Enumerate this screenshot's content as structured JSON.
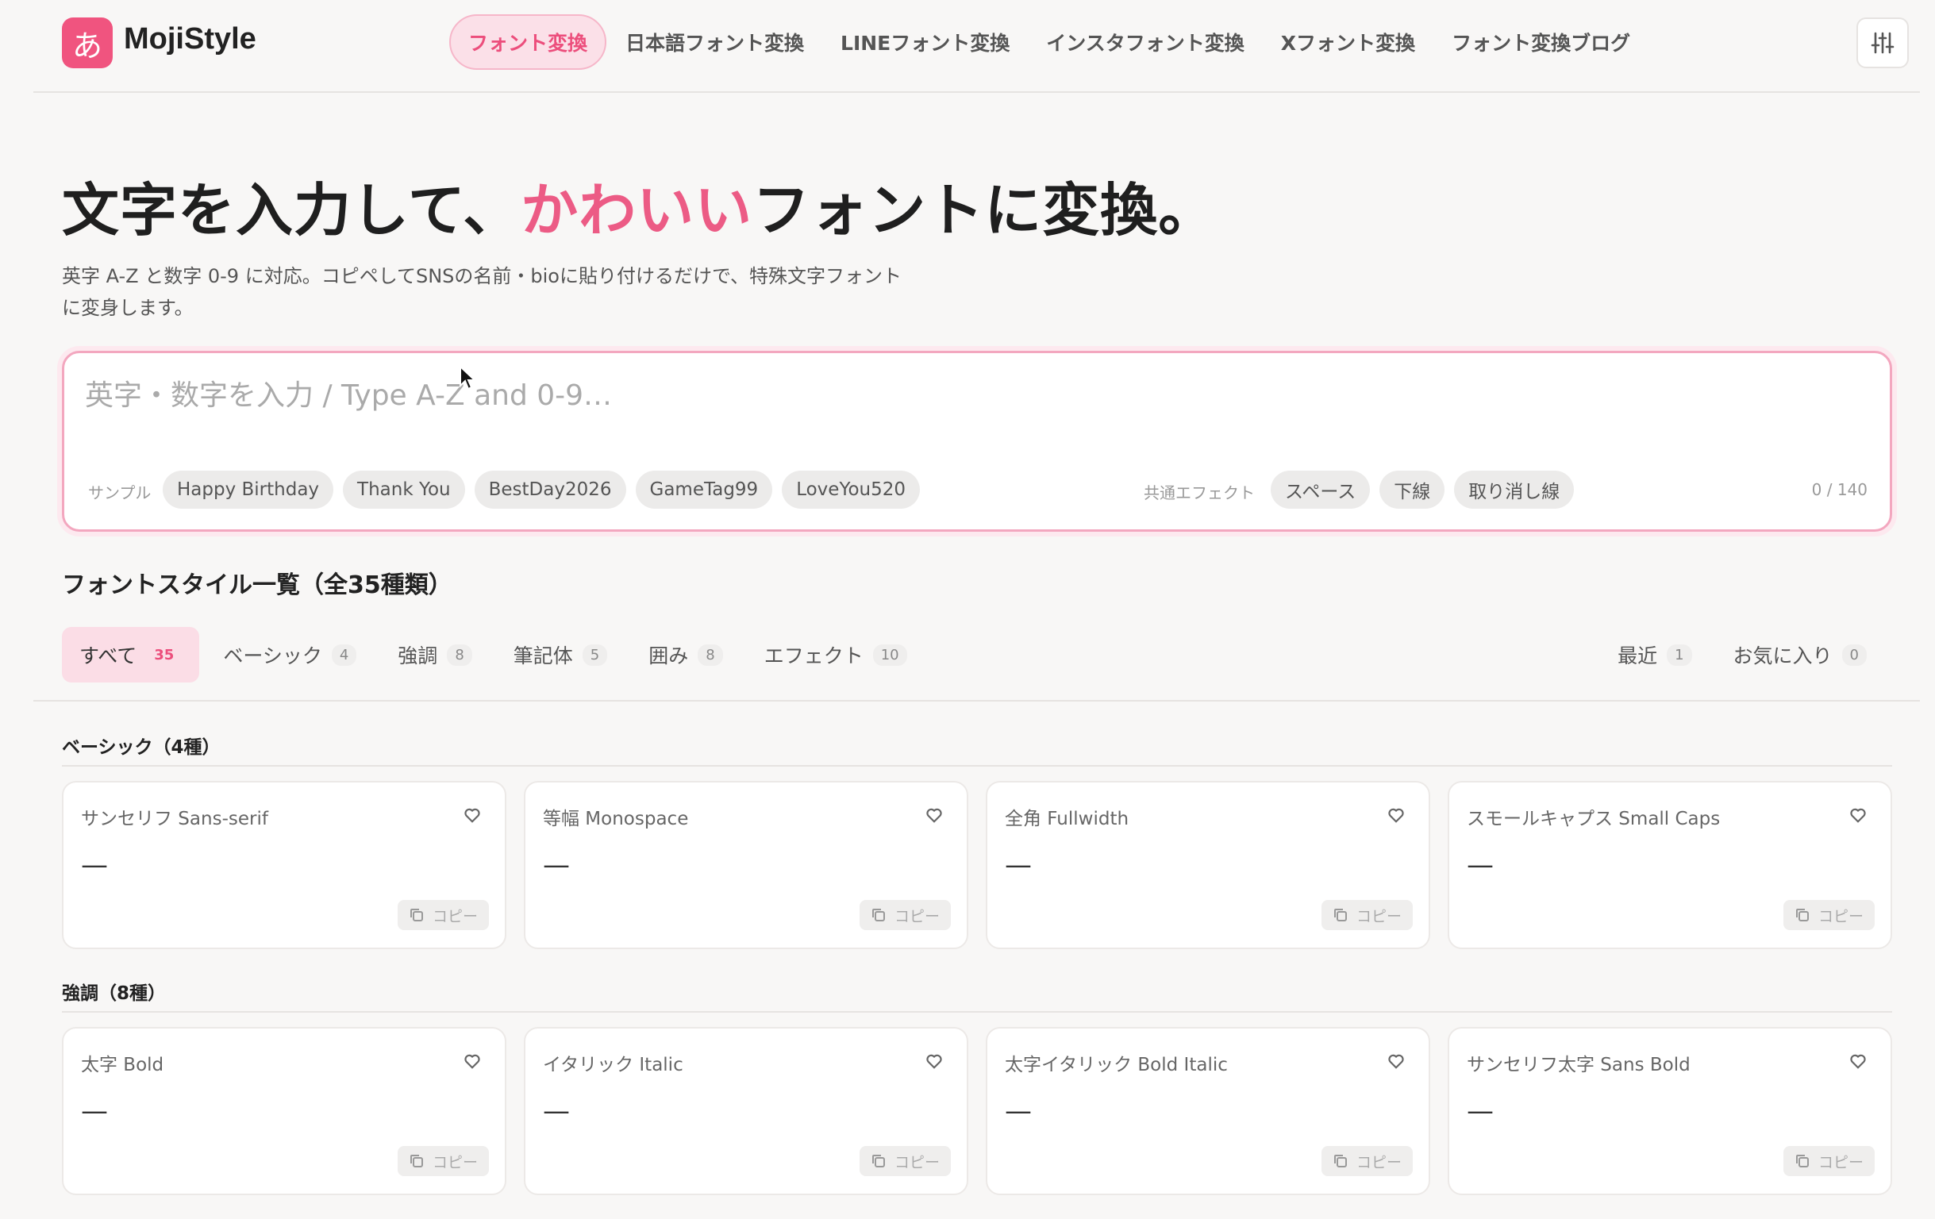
{
  "header": {
    "logo_mark": "あ",
    "logo_text": "MojiStyle",
    "nav": [
      {
        "label": "フォント変換",
        "active": true
      },
      {
        "label": "日本語フォント変換"
      },
      {
        "label": "LINEフォント変換"
      },
      {
        "label": "インスタフォント変換"
      },
      {
        "label": "Xフォント変換"
      },
      {
        "label": "フォント変換ブログ"
      }
    ],
    "settings_icon": "sliders-icon"
  },
  "hero": {
    "title_pre": "文字を入力して、",
    "title_accent": "かわいい",
    "title_post": "フォントに変換。",
    "desc": "英字 A-Z と数字 0-9 に対応。コピペしてSNSの名前・bioに貼り付けるだけで、特殊文字フォントに変身します。"
  },
  "input": {
    "value": "",
    "placeholder": "英字・数字を入力 / Type A-Z and 0-9…",
    "sample_label": "サンプル",
    "samples": [
      "Happy Birthday",
      "Thank You",
      "BestDay2026",
      "GameTag99",
      "LoveYou520"
    ],
    "effect_label": "共通エフェクト",
    "effects": [
      "スペース",
      "下線",
      "取り消し線"
    ],
    "counter": "0 / 140"
  },
  "list": {
    "title": "フォントスタイル一覧（全35種類）",
    "tabs": [
      {
        "label": "すべて",
        "count": "35",
        "active": true
      },
      {
        "label": "ベーシック",
        "count": "4"
      },
      {
        "label": "強調",
        "count": "8"
      },
      {
        "label": "筆記体",
        "count": "5"
      },
      {
        "label": "囲み",
        "count": "8"
      },
      {
        "label": "エフェクト",
        "count": "10"
      }
    ],
    "tabs_right": [
      {
        "label": "最近",
        "count": "1"
      },
      {
        "label": "お気に入り",
        "count": "0"
      }
    ]
  },
  "categories": [
    {
      "title": "ベーシック（4種）",
      "cards": [
        {
          "name": "サンセリフ Sans-serif",
          "preview": "—",
          "copy": "コピー"
        },
        {
          "name": "等幅 Monospace",
          "preview": "—",
          "copy": "コピー"
        },
        {
          "name": "全角 Fullwidth",
          "preview": "—",
          "copy": "コピー"
        },
        {
          "name": "スモールキャプス Small Caps",
          "preview": "—",
          "copy": "コピー"
        }
      ]
    },
    {
      "title": "強調（8種）",
      "cards": [
        {
          "name": "太字 Bold",
          "preview": "—",
          "copy": "コピー"
        },
        {
          "name": "イタリック Italic",
          "preview": "—",
          "copy": "コピー"
        },
        {
          "name": "太字イタリック Bold Italic",
          "preview": "—",
          "copy": "コピー"
        },
        {
          "name": "サンセリフ太字 Sans Bold",
          "preview": "—",
          "copy": "コピー"
        }
      ]
    }
  ],
  "colors": {
    "accent": "#ec5b85",
    "accent_bg": "#fbdde6",
    "logo": "#f0547f"
  }
}
